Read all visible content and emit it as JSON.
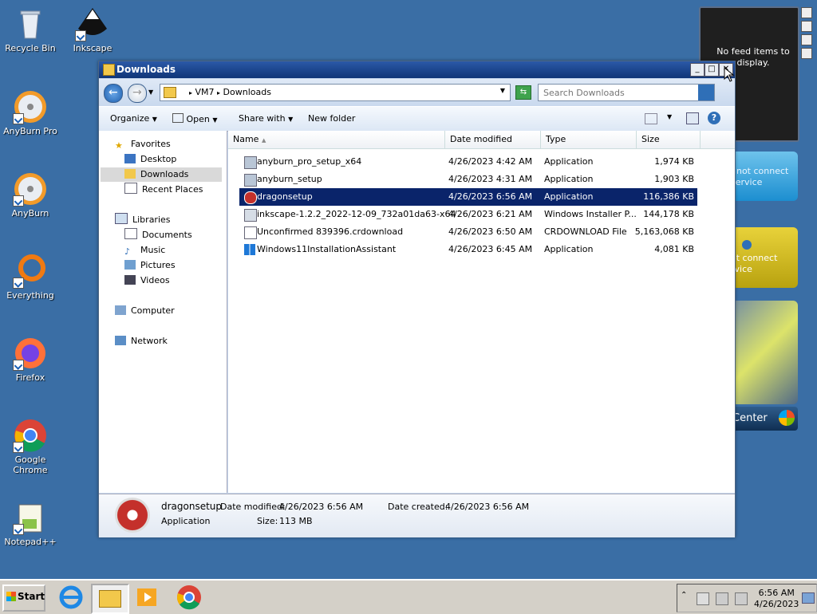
{
  "desktop": {
    "icons": [
      {
        "label": "Recycle Bin"
      },
      {
        "label": "Inkscape"
      },
      {
        "label": "AnyBurn Pro"
      },
      {
        "label": "AnyBurn"
      },
      {
        "label": "Everything"
      },
      {
        "label": "Firefox"
      },
      {
        "label": "Google Chrome"
      },
      {
        "label": "Notepad++"
      }
    ]
  },
  "gadgets": {
    "feed": "No feed items to display.",
    "blue": "nnot connect\nservice",
    "yellow": "ot connect\nrvice",
    "center": "Center"
  },
  "window": {
    "title": "Downloads",
    "address": {
      "root": "VM7",
      "folder": "Downloads"
    },
    "search_placeholder": "Search Downloads",
    "toolbar": {
      "organize": "Organize",
      "open": "Open",
      "share": "Share with",
      "new_folder": "New folder"
    },
    "nav": {
      "favorites": "Favorites",
      "desktop": "Desktop",
      "downloads": "Downloads",
      "recent": "Recent Places",
      "libraries": "Libraries",
      "documents": "Documents",
      "music": "Music",
      "pictures": "Pictures",
      "videos": "Videos",
      "computer": "Computer",
      "network": "Network"
    },
    "columns": {
      "name": "Name",
      "date": "Date modified",
      "type": "Type",
      "size": "Size"
    },
    "files": [
      {
        "name": "anyburn_pro_setup_x64",
        "date": "4/26/2023 4:42 AM",
        "type": "Application",
        "size": "1,974 KB"
      },
      {
        "name": "anyburn_setup",
        "date": "4/26/2023 4:31 AM",
        "type": "Application",
        "size": "1,903 KB"
      },
      {
        "name": "dragonsetup",
        "date": "4/26/2023 6:56 AM",
        "type": "Application",
        "size": "116,386 KB"
      },
      {
        "name": "inkscape-1.2.2_2022-12-09_732a01da63-x64",
        "date": "4/26/2023 6:21 AM",
        "type": "Windows Installer P...",
        "size": "144,178 KB"
      },
      {
        "name": "Unconfirmed 839396.crdownload",
        "date": "4/26/2023 6:50 AM",
        "type": "CRDOWNLOAD File",
        "size": "5,163,068 KB"
      },
      {
        "name": "Windows11InstallationAssistant",
        "date": "4/26/2023 6:45 AM",
        "type": "Application",
        "size": "4,081 KB"
      }
    ],
    "details": {
      "name": "dragonsetup",
      "modified_label": "Date modified:",
      "modified": "4/26/2023 6:56 AM",
      "created_label": "Date created:",
      "created": "4/26/2023 6:56 AM",
      "type": "Application",
      "size_label": "Size:",
      "size": "113 MB"
    }
  },
  "taskbar": {
    "start": "Start",
    "time": "6:56 AM",
    "date": "4/26/2023"
  }
}
